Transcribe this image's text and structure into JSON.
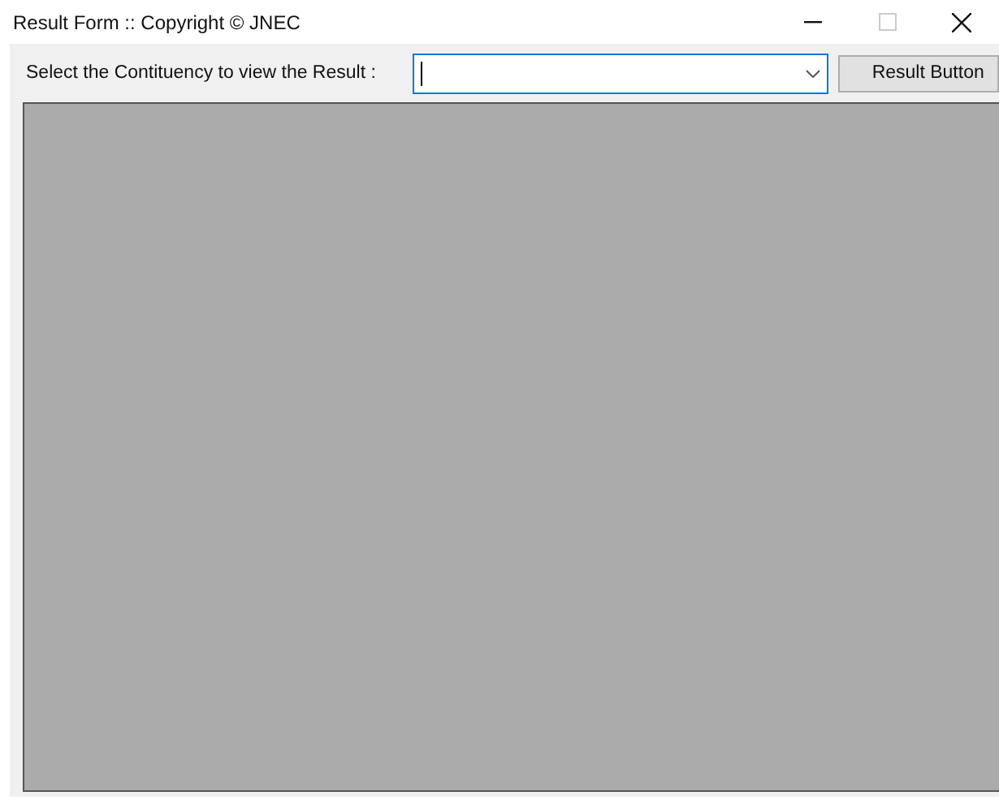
{
  "window": {
    "title": "Result Form :: Copyright © JNEC",
    "maximize_disabled": true
  },
  "toolbar": {
    "label": "Select the Contituency to view the Result :",
    "combo": {
      "focused": true
    },
    "button": "Result Button"
  }
}
